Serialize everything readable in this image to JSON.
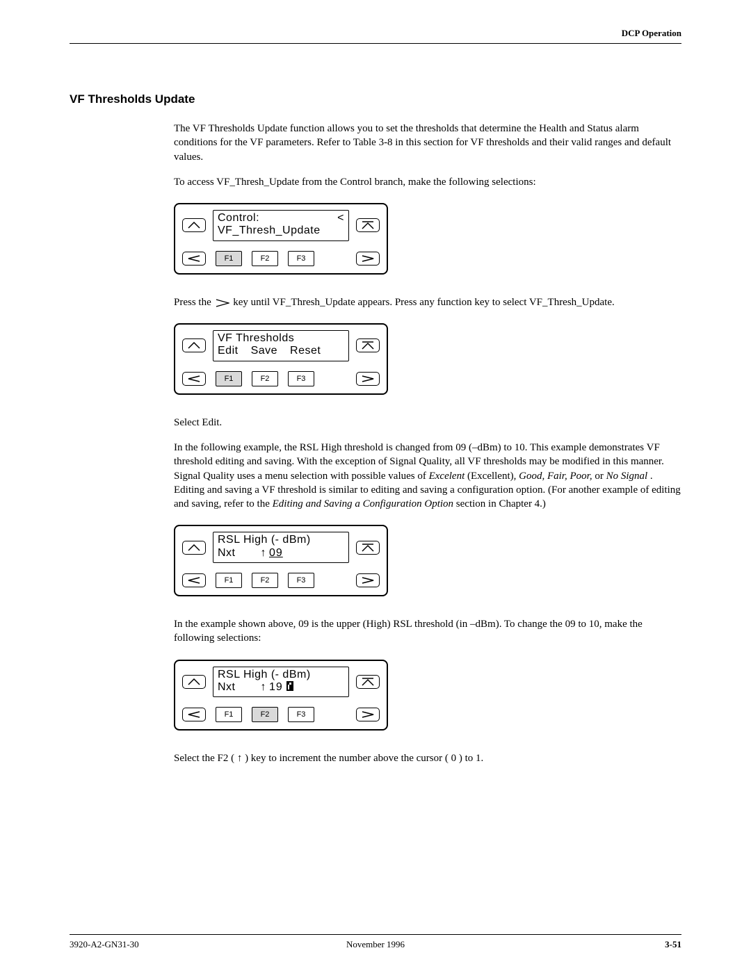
{
  "header": {
    "right": "DCP Operation"
  },
  "section_title": "VF Thresholds Update",
  "para1": "The VF Thresholds Update function allows you to set the thresholds that determine the Health and Status alarm conditions for the VF parameters. Refer to Table 3-8 in this section for VF thresholds and their valid ranges and default values.",
  "para2": "To access VF_Thresh_Update from the Control branch, make the following selections:",
  "panel1": {
    "line1_left": "Control:",
    "line1_right": "<",
    "line2": "VF_Thresh_Update",
    "f1": "F1",
    "f2": "F2",
    "f3": "F3",
    "f1_shaded": true,
    "f2_shaded": false,
    "f3_shaded": false
  },
  "para3a": "Press the ",
  "para3b": " key until VF_Thresh_Update appears. Press any function key to select VF_Thresh_Update.",
  "panel2": {
    "line1": "VF Thresholds",
    "opt1": "Edit",
    "opt2": "Save",
    "opt3": "Reset",
    "f1": "F1",
    "f2": "F2",
    "f3": "F3",
    "f1_shaded": true,
    "f2_shaded": false,
    "f3_shaded": false
  },
  "para4": "Select Edit.",
  "para5_parts": {
    "a": "In the following example, the RSL High threshold is changed from 09 (–dBm) to 10. This example demonstrates VF threshold editing and saving. With the exception of Signal Quality, all VF thresholds may be modified in this manner. Signal Quality uses a menu selection with possible values of ",
    "excelent": "Excelent",
    "b": " (Excellent), ",
    "good": "Good, Fair, Poor,",
    "c": " or ",
    "nosignal": "No Signal",
    "d": ". Editing and saving a VF threshold is similar to editing and saving a configuration option. (For another example of editing and saving, refer to the ",
    "link": "Editing and Saving a Configuration Option",
    "e": " section in Chapter 4.)"
  },
  "panel3": {
    "line1": "RSL High (- dBm)",
    "nxt": "Nxt",
    "arrow": "↑",
    "val": "09",
    "f1": "F1",
    "f2": "F2",
    "f3": "F3",
    "f1_shaded": false,
    "f2_shaded": false,
    "f3_shaded": false
  },
  "para6": "In the example shown above, 09 is the upper (High) RSL threshold (in –dBm). To change the 09 to 10, make the following selections:",
  "panel4": {
    "line1": "RSL High (- dBm)",
    "nxt": "Nxt",
    "arrow": "↑",
    "val": "19",
    "f1": "F1",
    "f2": "F2",
    "f3": "F3",
    "f1_shaded": false,
    "f2_shaded": true,
    "f3_shaded": false
  },
  "para7": "Select the F2 ( ↑ ) key to increment the number above the cursor ( 0 ) to 1.",
  "footer": {
    "left": "3920-A2-GN31-30",
    "center": "November 1996",
    "right": "3-51"
  },
  "chart_data": {
    "type": "table",
    "description": "LCD panel screens depicted in a technical manual",
    "panels": [
      {
        "title": "Control: <",
        "subtitle": "VF_Thresh_Update",
        "highlighted_fkey": "F1"
      },
      {
        "title": "VF Thresholds",
        "options": [
          "Edit",
          "Save",
          "Reset"
        ],
        "highlighted_fkey": "F1"
      },
      {
        "title": "RSL High (-dBm)",
        "fields": {
          "Nxt": "",
          "value": "09",
          "arrow": "↑"
        },
        "highlighted_fkey": null
      },
      {
        "title": "RSL High (-dBm)",
        "fields": {
          "Nxt": "",
          "value": "19",
          "arrow": "↑",
          "cursor_on_digit": 1
        },
        "highlighted_fkey": "F2"
      }
    ]
  }
}
